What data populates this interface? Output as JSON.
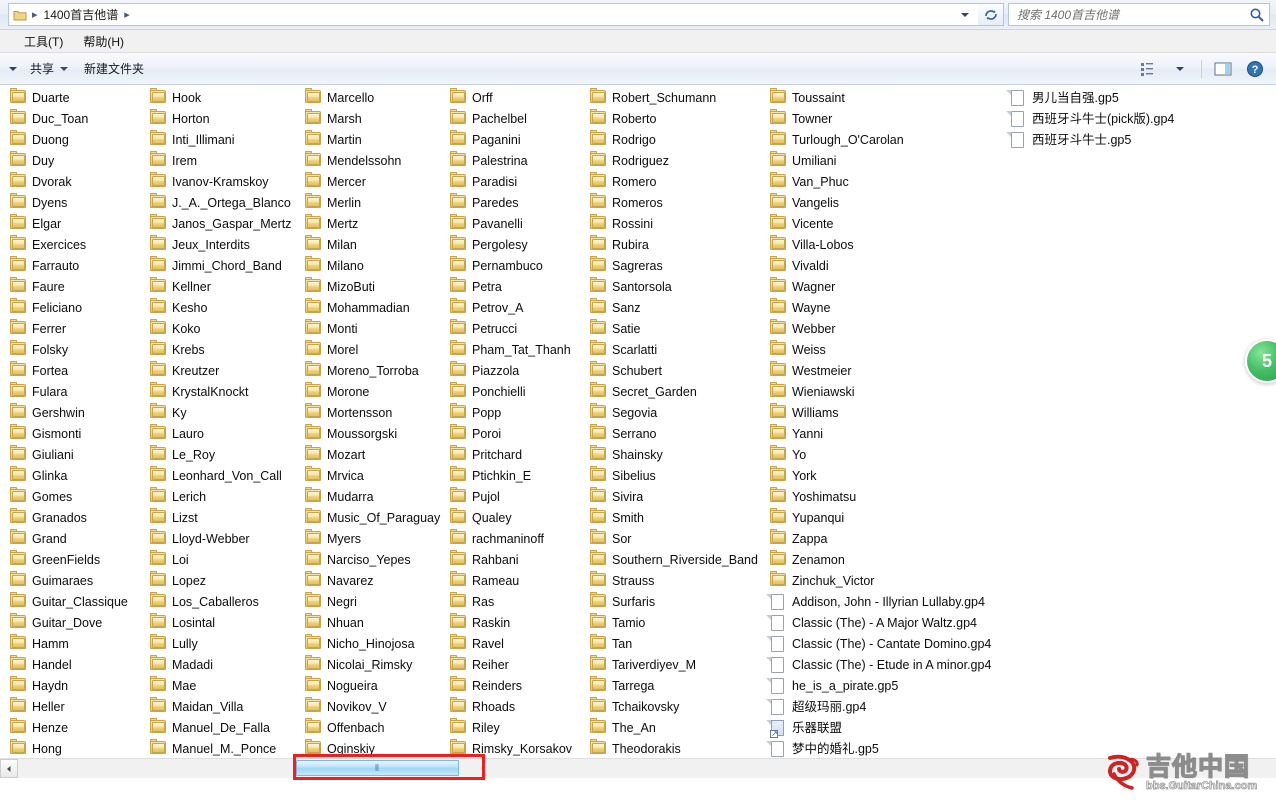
{
  "window": {
    "addressbar": {
      "crumb_root": "",
      "crumb_current": "1400首吉他谱",
      "separator": "▸",
      "refresh_icon": "refresh-icon",
      "dropdown_icon": "chevron-down-icon"
    },
    "search": {
      "placeholder": "搜索 1400首吉他谱",
      "icon": "search-icon"
    },
    "menubar": {
      "items": [
        {
          "label": "工具(T)",
          "name": "menu-tools"
        },
        {
          "label": "帮助(H)",
          "name": "menu-help"
        }
      ]
    },
    "toolbar": {
      "share_label": "共享",
      "new_folder_label": "新建文件夹",
      "view_icon": "view-list-icon",
      "preview_pane_icon": "preview-pane-icon",
      "help_icon": "help-circle-icon"
    },
    "scrollbar": {
      "left_arrow": "◄",
      "grip": "⦀",
      "highlighted": true,
      "highlight_color": "#f01e1e"
    },
    "badge": {
      "label": "5",
      "color": "#3fb95c"
    },
    "watermark": {
      "title": "吉他中国",
      "url": "bbs.GuitarChina.com"
    }
  },
  "listing": {
    "columns": [
      {
        "name": "column-1",
        "entries": [
          {
            "label": "Duarte",
            "type": "folder"
          },
          {
            "label": "Duc_Toan",
            "type": "folder"
          },
          {
            "label": "Duong",
            "type": "folder"
          },
          {
            "label": "Duy",
            "type": "folder"
          },
          {
            "label": "Dvorak",
            "type": "folder"
          },
          {
            "label": "Dyens",
            "type": "folder"
          },
          {
            "label": "Elgar",
            "type": "folder"
          },
          {
            "label": "Exercices",
            "type": "folder"
          },
          {
            "label": "Farrauto",
            "type": "folder"
          },
          {
            "label": "Faure",
            "type": "folder"
          },
          {
            "label": "Feliciano",
            "type": "folder"
          },
          {
            "label": "Ferrer",
            "type": "folder"
          },
          {
            "label": "Folsky",
            "type": "folder"
          },
          {
            "label": "Fortea",
            "type": "folder"
          },
          {
            "label": "Fulara",
            "type": "folder"
          },
          {
            "label": "Gershwin",
            "type": "folder"
          },
          {
            "label": "Gismonti",
            "type": "folder"
          },
          {
            "label": "Giuliani",
            "type": "folder"
          },
          {
            "label": "Glinka",
            "type": "folder"
          },
          {
            "label": "Gomes",
            "type": "folder"
          },
          {
            "label": "Granados",
            "type": "folder"
          },
          {
            "label": "Grand",
            "type": "folder"
          },
          {
            "label": "GreenFields",
            "type": "folder"
          },
          {
            "label": "Guimaraes",
            "type": "folder"
          },
          {
            "label": "Guitar_Classique",
            "type": "folder"
          },
          {
            "label": "Guitar_Dove",
            "type": "folder"
          },
          {
            "label": "Hamm",
            "type": "folder"
          },
          {
            "label": "Handel",
            "type": "folder"
          },
          {
            "label": "Haydn",
            "type": "folder"
          },
          {
            "label": "Heller",
            "type": "folder"
          },
          {
            "label": "Henze",
            "type": "folder"
          },
          {
            "label": "Hong",
            "type": "folder"
          }
        ]
      },
      {
        "name": "column-2",
        "entries": [
          {
            "label": "Hook",
            "type": "folder"
          },
          {
            "label": "Horton",
            "type": "folder"
          },
          {
            "label": "Inti_Illimani",
            "type": "folder"
          },
          {
            "label": "Irem",
            "type": "folder"
          },
          {
            "label": "Ivanov-Kramskoy",
            "type": "folder"
          },
          {
            "label": "J._A._Ortega_Blanco",
            "type": "folder"
          },
          {
            "label": "Janos_Gaspar_Mertz",
            "type": "folder"
          },
          {
            "label": "Jeux_Interdits",
            "type": "folder"
          },
          {
            "label": "Jimmi_Chord_Band",
            "type": "folder"
          },
          {
            "label": "Kellner",
            "type": "folder"
          },
          {
            "label": "Kesho",
            "type": "folder"
          },
          {
            "label": "Koko",
            "type": "folder"
          },
          {
            "label": "Krebs",
            "type": "folder"
          },
          {
            "label": "Kreutzer",
            "type": "folder"
          },
          {
            "label": "KrystalKnockt",
            "type": "folder"
          },
          {
            "label": "Ky",
            "type": "folder"
          },
          {
            "label": "Lauro",
            "type": "folder"
          },
          {
            "label": "Le_Roy",
            "type": "folder"
          },
          {
            "label": "Leonhard_Von_Call",
            "type": "folder"
          },
          {
            "label": "Lerich",
            "type": "folder"
          },
          {
            "label": "Lizst",
            "type": "folder"
          },
          {
            "label": "Lloyd-Webber",
            "type": "folder"
          },
          {
            "label": "Loi",
            "type": "folder"
          },
          {
            "label": "Lopez",
            "type": "folder"
          },
          {
            "label": "Los_Caballeros",
            "type": "folder"
          },
          {
            "label": "Losintal",
            "type": "folder"
          },
          {
            "label": "Lully",
            "type": "folder"
          },
          {
            "label": "Madadi",
            "type": "folder"
          },
          {
            "label": "Mae",
            "type": "folder"
          },
          {
            "label": "Maidan_Villa",
            "type": "folder"
          },
          {
            "label": "Manuel_De_Falla",
            "type": "folder"
          },
          {
            "label": "Manuel_M._Ponce",
            "type": "folder"
          }
        ]
      },
      {
        "name": "column-3",
        "entries": [
          {
            "label": "Marcello",
            "type": "folder"
          },
          {
            "label": "Marsh",
            "type": "folder"
          },
          {
            "label": "Martin",
            "type": "folder"
          },
          {
            "label": "Mendelssohn",
            "type": "folder"
          },
          {
            "label": "Mercer",
            "type": "folder"
          },
          {
            "label": "Merlin",
            "type": "folder"
          },
          {
            "label": "Mertz",
            "type": "folder"
          },
          {
            "label": "Milan",
            "type": "folder"
          },
          {
            "label": "Milano",
            "type": "folder"
          },
          {
            "label": "MizoButi",
            "type": "folder"
          },
          {
            "label": "Mohammadian",
            "type": "folder"
          },
          {
            "label": "Monti",
            "type": "folder"
          },
          {
            "label": "Morel",
            "type": "folder"
          },
          {
            "label": "Moreno_Torroba",
            "type": "folder"
          },
          {
            "label": "Morone",
            "type": "folder"
          },
          {
            "label": "Mortensson",
            "type": "folder"
          },
          {
            "label": "Moussorgski",
            "type": "folder"
          },
          {
            "label": "Mozart",
            "type": "folder"
          },
          {
            "label": "Mrvica",
            "type": "folder"
          },
          {
            "label": "Mudarra",
            "type": "folder"
          },
          {
            "label": "Music_Of_Paraguay",
            "type": "folder"
          },
          {
            "label": "Myers",
            "type": "folder"
          },
          {
            "label": "Narciso_Yepes",
            "type": "folder"
          },
          {
            "label": "Navarez",
            "type": "folder"
          },
          {
            "label": "Negri",
            "type": "folder"
          },
          {
            "label": "Nhuan",
            "type": "folder"
          },
          {
            "label": "Nicho_Hinojosa",
            "type": "folder"
          },
          {
            "label": "Nicolai_Rimsky",
            "type": "folder"
          },
          {
            "label": "Nogueira",
            "type": "folder"
          },
          {
            "label": "Novikov_V",
            "type": "folder"
          },
          {
            "label": "Offenbach",
            "type": "folder"
          },
          {
            "label": "Oginskiy",
            "type": "folder"
          }
        ]
      },
      {
        "name": "column-4",
        "entries": [
          {
            "label": "Orff",
            "type": "folder"
          },
          {
            "label": "Pachelbel",
            "type": "folder"
          },
          {
            "label": "Paganini",
            "type": "folder"
          },
          {
            "label": "Palestrina",
            "type": "folder"
          },
          {
            "label": "Paradisi",
            "type": "folder"
          },
          {
            "label": "Paredes",
            "type": "folder"
          },
          {
            "label": "Pavanelli",
            "type": "folder"
          },
          {
            "label": "Pergolesy",
            "type": "folder"
          },
          {
            "label": "Pernambuco",
            "type": "folder"
          },
          {
            "label": "Petra",
            "type": "folder"
          },
          {
            "label": "Petrov_A",
            "type": "folder"
          },
          {
            "label": "Petrucci",
            "type": "folder"
          },
          {
            "label": "Pham_Tat_Thanh",
            "type": "folder"
          },
          {
            "label": "Piazzola",
            "type": "folder"
          },
          {
            "label": "Ponchielli",
            "type": "folder"
          },
          {
            "label": "Popp",
            "type": "folder"
          },
          {
            "label": "Poroi",
            "type": "folder"
          },
          {
            "label": "Pritchard",
            "type": "folder"
          },
          {
            "label": "Ptichkin_E",
            "type": "folder"
          },
          {
            "label": "Pujol",
            "type": "folder"
          },
          {
            "label": "Qualey",
            "type": "folder"
          },
          {
            "label": "rachmaninoff",
            "type": "folder"
          },
          {
            "label": "Rahbani",
            "type": "folder"
          },
          {
            "label": "Rameau",
            "type": "folder"
          },
          {
            "label": "Ras",
            "type": "folder"
          },
          {
            "label": "Raskin",
            "type": "folder"
          },
          {
            "label": "Ravel",
            "type": "folder"
          },
          {
            "label": "Reiher",
            "type": "folder"
          },
          {
            "label": "Reinders",
            "type": "folder"
          },
          {
            "label": "Rhoads",
            "type": "folder"
          },
          {
            "label": "Riley",
            "type": "folder"
          },
          {
            "label": "Rimsky_Korsakov",
            "type": "folder"
          }
        ]
      },
      {
        "name": "column-5",
        "entries": [
          {
            "label": "Robert_Schumann",
            "type": "folder"
          },
          {
            "label": "Roberto",
            "type": "folder"
          },
          {
            "label": "Rodrigo",
            "type": "folder"
          },
          {
            "label": "Rodriguez",
            "type": "folder"
          },
          {
            "label": "Romero",
            "type": "folder"
          },
          {
            "label": "Romeros",
            "type": "folder"
          },
          {
            "label": "Rossini",
            "type": "folder"
          },
          {
            "label": "Rubira",
            "type": "folder"
          },
          {
            "label": "Sagreras",
            "type": "folder"
          },
          {
            "label": "Santorsola",
            "type": "folder"
          },
          {
            "label": "Sanz",
            "type": "folder"
          },
          {
            "label": "Satie",
            "type": "folder"
          },
          {
            "label": "Scarlatti",
            "type": "folder"
          },
          {
            "label": "Schubert",
            "type": "folder"
          },
          {
            "label": "Secret_Garden",
            "type": "folder"
          },
          {
            "label": "Segovia",
            "type": "folder"
          },
          {
            "label": "Serrano",
            "type": "folder"
          },
          {
            "label": "Shainsky",
            "type": "folder"
          },
          {
            "label": "Sibelius",
            "type": "folder"
          },
          {
            "label": "Sivira",
            "type": "folder"
          },
          {
            "label": "Smith",
            "type": "folder"
          },
          {
            "label": "Sor",
            "type": "folder"
          },
          {
            "label": "Southern_Riverside_Band",
            "type": "folder"
          },
          {
            "label": "Strauss",
            "type": "folder"
          },
          {
            "label": "Surfaris",
            "type": "folder"
          },
          {
            "label": "Tamio",
            "type": "folder"
          },
          {
            "label": "Tan",
            "type": "folder"
          },
          {
            "label": "Tariverdiyev_M",
            "type": "folder"
          },
          {
            "label": "Tarrega",
            "type": "folder"
          },
          {
            "label": "Tchaikovsky",
            "type": "folder"
          },
          {
            "label": "The_An",
            "type": "folder"
          },
          {
            "label": "Theodorakis",
            "type": "folder"
          }
        ]
      },
      {
        "name": "column-6",
        "entries": [
          {
            "label": "Toussaint",
            "type": "folder"
          },
          {
            "label": "Towner",
            "type": "folder"
          },
          {
            "label": "Turlough_O'Carolan",
            "type": "folder"
          },
          {
            "label": "Umiliani",
            "type": "folder"
          },
          {
            "label": "Van_Phuc",
            "type": "folder"
          },
          {
            "label": "Vangelis",
            "type": "folder"
          },
          {
            "label": "Vicente",
            "type": "folder"
          },
          {
            "label": "Villa-Lobos",
            "type": "folder"
          },
          {
            "label": "Vivaldi",
            "type": "folder"
          },
          {
            "label": "Wagner",
            "type": "folder"
          },
          {
            "label": "Wayne",
            "type": "folder"
          },
          {
            "label": "Webber",
            "type": "folder"
          },
          {
            "label": "Weiss",
            "type": "folder"
          },
          {
            "label": "Westmeier",
            "type": "folder"
          },
          {
            "label": "Wieniawski",
            "type": "folder"
          },
          {
            "label": "Williams",
            "type": "folder"
          },
          {
            "label": "Yanni",
            "type": "folder"
          },
          {
            "label": "Yo",
            "type": "folder"
          },
          {
            "label": "York",
            "type": "folder"
          },
          {
            "label": "Yoshimatsu",
            "type": "folder"
          },
          {
            "label": "Yupanqui",
            "type": "folder"
          },
          {
            "label": "Zappa",
            "type": "folder"
          },
          {
            "label": "Zenamon",
            "type": "folder"
          },
          {
            "label": "Zinchuk_Victor",
            "type": "folder"
          },
          {
            "label": "Addison, John - Illyrian Lullaby.gp4",
            "type": "file"
          },
          {
            "label": "Classic (The) - A Major Waltz.gp4",
            "type": "file"
          },
          {
            "label": "Classic (The) - Cantate Domino.gp4",
            "type": "file"
          },
          {
            "label": "Classic (The) - Etude in A minor.gp4",
            "type": "file"
          },
          {
            "label": "he_is_a_pirate.gp5",
            "type": "file"
          },
          {
            "label": "超级玛丽.gp4",
            "type": "file"
          },
          {
            "label": "乐器联盟",
            "type": "shortcut"
          },
          {
            "label": "梦中的婚礼.gp5",
            "type": "file"
          }
        ]
      },
      {
        "name": "column-7",
        "entries": [
          {
            "label": "男儿当自强.gp5",
            "type": "file"
          },
          {
            "label": "西班牙斗牛士(pick版).gp4",
            "type": "file"
          },
          {
            "label": "西班牙斗牛士.gp5",
            "type": "file"
          }
        ]
      }
    ]
  }
}
